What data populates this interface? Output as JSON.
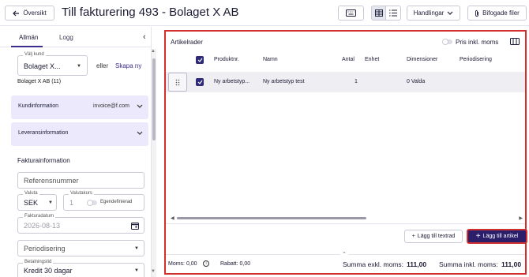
{
  "header": {
    "back_label": "Översikt",
    "title": "Till fakturering 493 - Bolaget X AB",
    "actions_label": "Handlingar",
    "attach_label": "Bifogade filer"
  },
  "left": {
    "tabs": [
      {
        "label": "Allmän",
        "active": true
      },
      {
        "label": "Logg",
        "active": false
      }
    ],
    "customer": {
      "legend": "Välj kund",
      "value": "Bolaget X...",
      "or_text": "eller",
      "create_link": "Skapa ny",
      "subtext": "Bolaget X AB (11)"
    },
    "customer_info": {
      "title": "Kundinformation",
      "email": "invoice@f.com"
    },
    "delivery_info": {
      "title": "Leveransinformation"
    },
    "invoice_section": {
      "title": "Fakturainformation"
    },
    "reference": {
      "placeholder": "Referensnummer"
    },
    "currency": {
      "legend": "Valuta",
      "value": "SEK"
    },
    "rate": {
      "legend": "Valutakurs",
      "value": "1",
      "toggle_label": "Egendefinierad"
    },
    "invoice_date": {
      "legend": "Fakturadatum",
      "value": "2026-08-13"
    },
    "period": {
      "placeholder": "Periodisering"
    },
    "payment_terms": {
      "legend": "Betalningstid",
      "value": "Kredit 30 dagar"
    }
  },
  "main": {
    "title": "Artikelrader",
    "vat_label": "Pris inkl. moms",
    "columns": [
      "Produktnr.",
      "Namn",
      "Antal",
      "Enhet",
      "Dimensioner",
      "Periodisering"
    ],
    "rows": [
      {
        "product_no": "Ny arbetstyp...",
        "name": "Ny arbetstyp test",
        "qty": "1",
        "unit": "",
        "dimensions": "0 Valda",
        "period": ""
      }
    ],
    "add_text_label": "Lägg till textrad",
    "add_article_label": "Lägg till artikel",
    "footer": {
      "vat": "Moms: 0,00",
      "rounding": "Rabatt: 0,00",
      "sum_excl_label": "Summa exkl. moms:",
      "sum_excl_value": "111,00",
      "sum_incl_label": "Summa inkl. moms:",
      "sum_incl_value": "111,00"
    }
  },
  "colors": {
    "accent": "#2b1e6b",
    "highlight": "#d32f2f",
    "accordion_bg": "#ebe9fb"
  },
  "icons": [
    "arrow-left-icon",
    "keyboard-icon",
    "grid-view-icon",
    "list-view-icon",
    "chevron-down-icon",
    "paperclip-icon",
    "chevron-left-icon",
    "calendar-icon",
    "columns-icon",
    "drag-handle-icon",
    "checkmark-icon",
    "plus-icon",
    "info-icon",
    "chevron-up-icon"
  ]
}
